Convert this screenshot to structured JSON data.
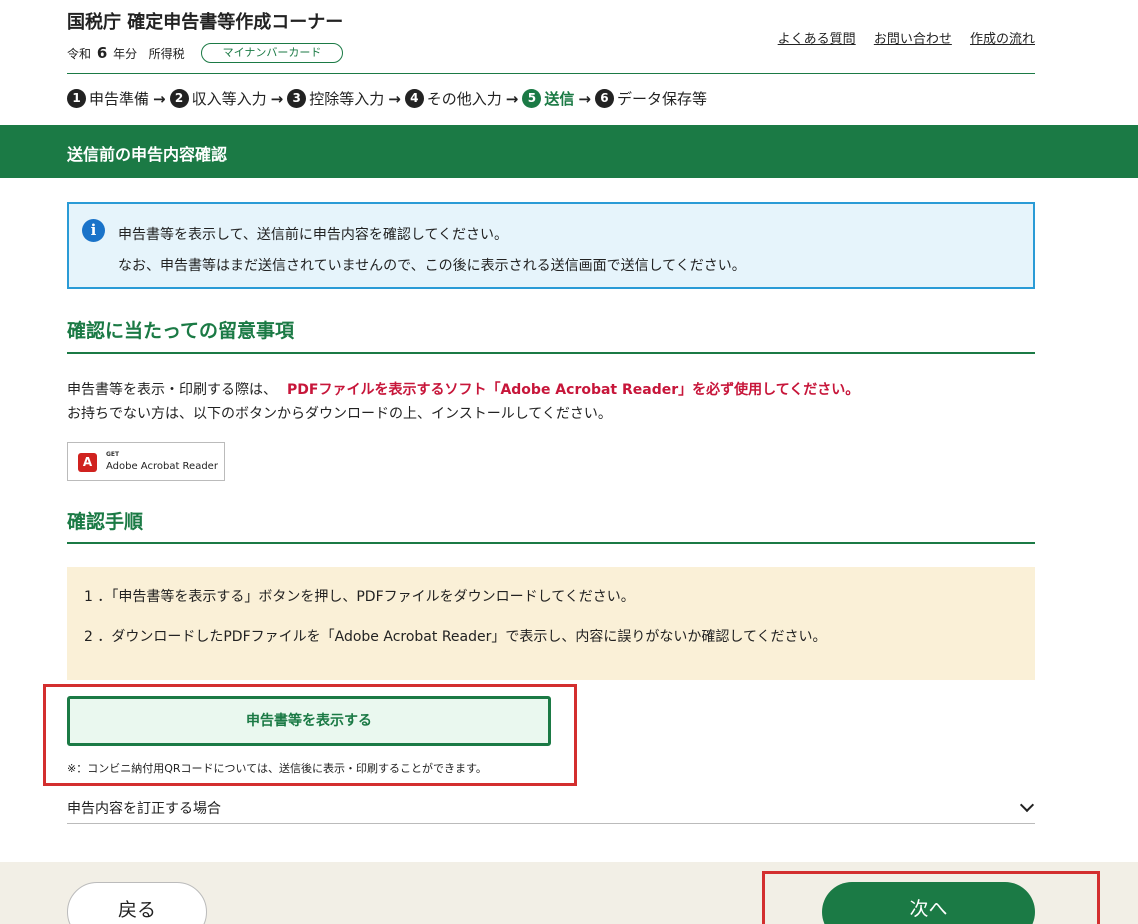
{
  "header": {
    "title": "国税庁 確定申告書等作成コーナー",
    "era": "令和",
    "year_num": "6",
    "year_suffix": "年分",
    "tax_type": "所得税",
    "badge": "マイナンバーカード",
    "links": [
      "よくある質問",
      "お問い合わせ",
      "作成の流れ"
    ]
  },
  "steps": [
    {
      "num": "1",
      "label": "申告準備"
    },
    {
      "num": "2",
      "label": "収入等入力"
    },
    {
      "num": "3",
      "label": "控除等入力"
    },
    {
      "num": "4",
      "label": "その他入力"
    },
    {
      "num": "5",
      "label": "送信",
      "active": true
    },
    {
      "num": "6",
      "label": "データ保存等"
    }
  ],
  "page_title": "送信前の申告内容確認",
  "info": {
    "icon": "info-icon",
    "line1": "申告書等を表示して、送信前に申告内容を確認してください。",
    "line2": "なお、申告書等はまだ送信されていませんので、この後に表示される送信画面で送信してください。"
  },
  "section1": {
    "heading": "確認に当たっての留意事項",
    "text_plain": "申告書等を表示・印刷する際は、",
    "text_red": "PDFファイルを表示するソフト「Adobe Acrobat Reader」を必ず使用してください。",
    "text_line2": "お持ちでない方は、以下のボタンからダウンロードの上、インストールしてください。",
    "adobe_get": "GET",
    "adobe_name": "Adobe Acrobat Reader"
  },
  "section2": {
    "heading": "確認手順",
    "step1": "1 ．「申告書等を表示する」ボタンを押し、PDFファイルをダウンロードしてください。",
    "step2": "2 ．ダウンロードしたPDFファイルを「Adobe Acrobat Reader」で表示し、内容に誤りがないか確認してください。"
  },
  "show_button": "申告書等を表示する",
  "qr_note": "※：コンビニ納付用QRコードについては、送信後に表示・印刷することができます。",
  "correction_label": "申告内容を訂正する場合",
  "footer": {
    "back": "戻る",
    "next": "次へ"
  },
  "colors": {
    "brand_green": "#1b7a45",
    "info_border": "#2a9bd6",
    "warning_red": "#c7163a",
    "highlight_red": "#d32f2f"
  }
}
